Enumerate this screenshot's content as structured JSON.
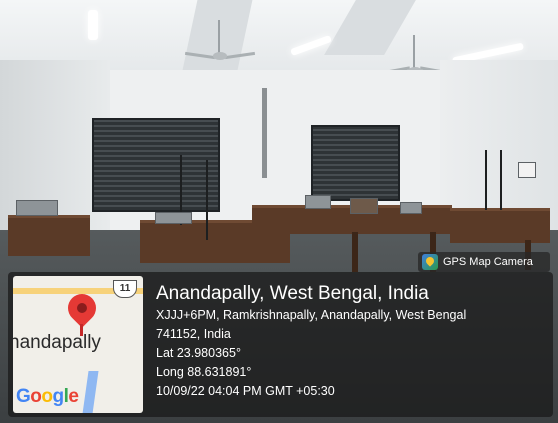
{
  "badge": {
    "label": "GPS Map Camera",
    "icon": "gps-map-camera-logo-icon"
  },
  "map": {
    "place_label": "nandapally",
    "highway_number": "11",
    "attribution": {
      "letters": [
        "G",
        "o",
        "o",
        "g",
        "l",
        "e"
      ]
    }
  },
  "location": {
    "title": "Anandapally, West Bengal, India",
    "address_line1": "XJJJ+6PM, Ramkrishnapally, Anandapally, West Bengal",
    "address_line2": "741152, India",
    "latitude": "Lat 23.980365°",
    "longitude": "Long 88.631891°",
    "timestamp": "10/09/22 04:04 PM GMT +05:30"
  },
  "colors": {
    "pin": "#e53935",
    "card_bg": "rgba(25,25,25,0.74)",
    "map_bg": "#f1efe9"
  }
}
